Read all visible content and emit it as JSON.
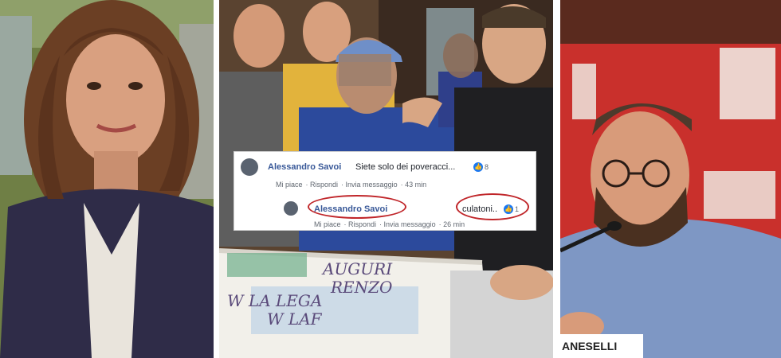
{
  "photos": {
    "left_desc": "Woman smiling, dark jacket",
    "middle_desc": "Group photo with cake",
    "right_desc": "Bearded man speaking at microphone"
  },
  "comments": [
    {
      "author": "Alessandro Savoi",
      "text": "Siete solo dei poveracci...",
      "likes": "8",
      "actions": [
        "Mi piace",
        "Rispondi",
        "Invia messaggio"
      ],
      "time": "43 min"
    },
    {
      "author": "Alessandro Savoi",
      "text": "culatoni..",
      "likes": "1",
      "actions": [
        "Mi piace",
        "Rispondi",
        "Invia messaggio"
      ],
      "time": "26 min"
    }
  ],
  "cake": {
    "line1": "AUGURI",
    "line2": "RENZO",
    "line3": "W LA LEGA",
    "line4": "W LAF"
  },
  "nameplate": {
    "text": "ANESELLI"
  },
  "colors": {
    "oval_red": "#c0262a",
    "fb_blue": "#385898",
    "banner_red": "#c9302c"
  }
}
